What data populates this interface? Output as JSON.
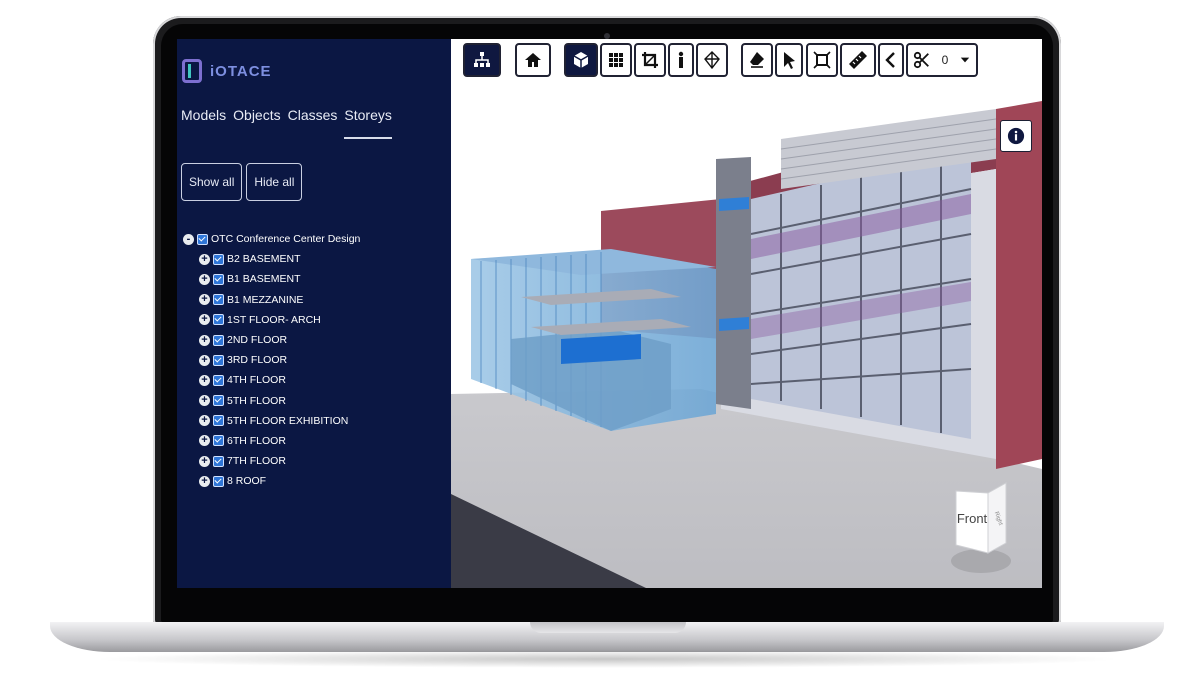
{
  "app": {
    "brand": "iOTACE"
  },
  "sidebar": {
    "tabs": [
      {
        "label": "Models"
      },
      {
        "label": "Objects"
      },
      {
        "label": "Classes"
      },
      {
        "label": "Storeys",
        "active": true
      }
    ],
    "buttons": {
      "show_all": "Show all",
      "hide_all": "Hide all"
    },
    "tree": {
      "root": "OTC Conference Center Design",
      "children": [
        "B2 BASEMENT",
        "B1 BASEMENT",
        "B1 MEZZANINE",
        "1ST FLOOR- ARCH",
        "2ND FLOOR",
        "3RD FLOOR",
        "4TH FLOOR",
        "5TH FLOOR",
        "5TH FLOOR EXHIBITION",
        "6TH FLOOR",
        "7TH FLOOR",
        "8 ROOF"
      ]
    }
  },
  "toolbar": {
    "icons": [
      "tree-structure-icon",
      "home-icon",
      "cube-icon",
      "grid-icon",
      "crop-icon",
      "person-icon",
      "wireframe-cube-icon",
      "eraser-icon",
      "pointer-icon",
      "section-box-icon",
      "ruler-icon",
      "chevron-left-icon",
      "scissors-icon"
    ],
    "section_count": "0"
  },
  "navcube": {
    "front": "Front",
    "right": "Right"
  },
  "colors": {
    "sidebar_bg": "#0b1743",
    "accent": "#2f76d8",
    "active_tool": "#0f1840"
  }
}
